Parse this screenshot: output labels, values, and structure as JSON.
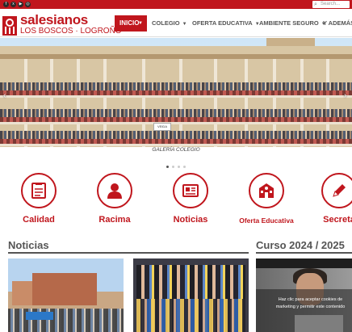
{
  "topbar": {
    "social_icons": [
      "facebook-icon",
      "x-twitter-icon",
      "youtube-icon",
      "instagram-icon"
    ],
    "search_placeholder": "Search..."
  },
  "brand": {
    "name": "salesianos",
    "subtitle": "LOS BOSCOS · LOGROÑO",
    "accent_color": "#c0161d"
  },
  "nav": {
    "active": "INICIO",
    "items": [
      "COLEGIO",
      "OFERTA EDUCATIVA",
      "AMBIENTE SEGURO",
      "Y ADEMÁS"
    ]
  },
  "hero": {
    "caption": "GALERÍA COLEGIO",
    "banner_text": "VEIDA",
    "slides_total": 4,
    "slide_active": 1
  },
  "features": [
    {
      "label": "Calidad",
      "icon": "checklist-icon"
    },
    {
      "label": "Racima",
      "icon": "user-icon"
    },
    {
      "label": "Noticias",
      "icon": "newspaper-icon"
    },
    {
      "label": "Oferta Educativa",
      "icon": "school-icon"
    },
    {
      "label": "Secreta",
      "icon": "pencil-icon"
    }
  ],
  "sections": {
    "news_title": "Noticias",
    "course_title": "Curso 2024 / 2025"
  },
  "cookie_notice": "Haz clic para aceptar cookies de marketing y permitir este contenido"
}
